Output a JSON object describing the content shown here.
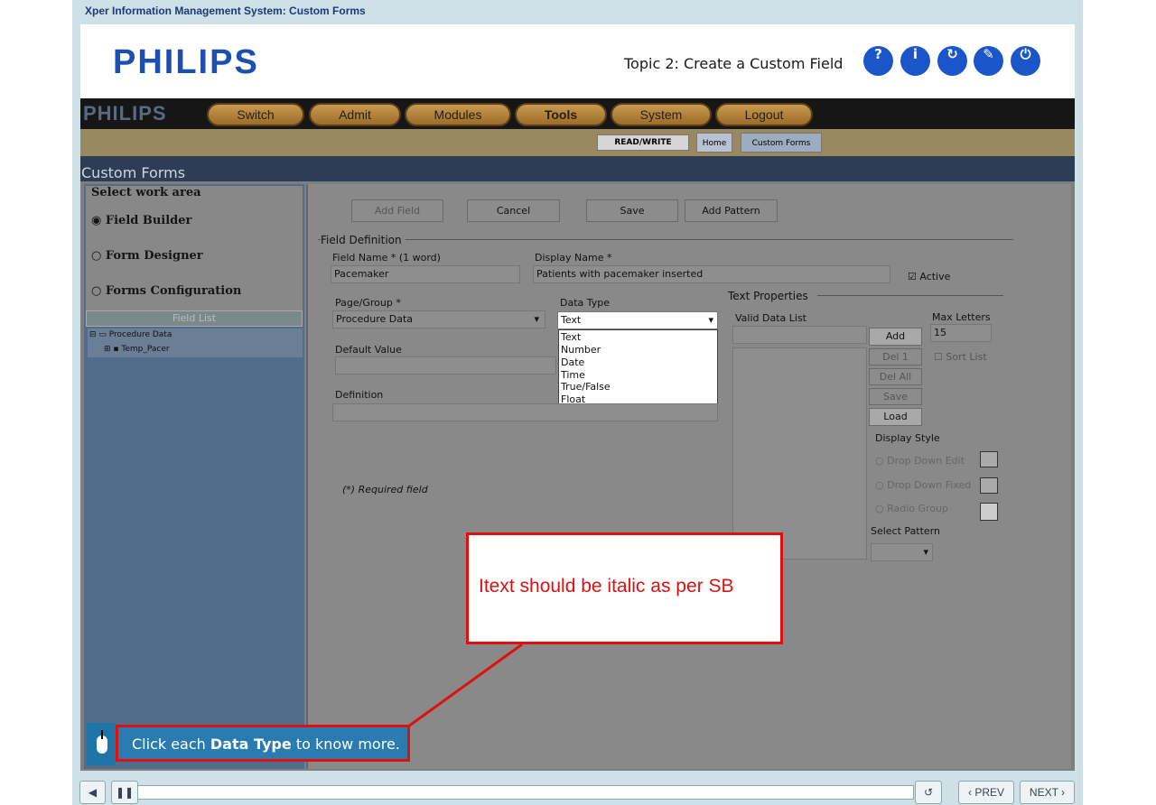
{
  "app_title": "Xper Information Management System: Custom Forms",
  "brand": "PHILIPS",
  "topic": "Topic 2: Create a Custom Field",
  "header_buttons": [
    {
      "icon": "help-icon",
      "glyph": "?"
    },
    {
      "icon": "info-icon",
      "glyph": "i"
    },
    {
      "icon": "replay-icon",
      "glyph": "↻"
    },
    {
      "icon": "pencil-icon",
      "glyph": "✎"
    },
    {
      "icon": "power-icon",
      "glyph": "⏻"
    }
  ],
  "app": {
    "logo": "PHILIPS",
    "menu": [
      "Switch",
      "Admit",
      "Modules",
      "Tools",
      "System",
      "Logout"
    ],
    "readwrite": "READ/WRITE",
    "tabs": [
      "Home",
      "Custom Forms"
    ],
    "section": "Custom Forms",
    "work_area_title": "Select work area",
    "work_areas": [
      "Field Builder",
      "Form Designer",
      "Forms Configuration"
    ],
    "field_list": "Field List",
    "tree": [
      "Procedure Data",
      "Temp_Pacer"
    ],
    "toolbar": [
      "Add Field",
      "Cancel",
      "Save",
      "Add Pattern"
    ],
    "field_definition": "Field Definition",
    "field_name_label": "Field Name  *  (1 word)",
    "field_name_value": "Pacemaker",
    "display_name_label": "Display Name  *",
    "display_name_value": "Patients with pacemaker inserted",
    "active_label": "Active",
    "page_group_label": "Page/Group  *",
    "page_group_value": "Procedure Data",
    "data_type_label": "Data Type",
    "data_type_value": "Text",
    "data_type_options": [
      "Text",
      "Number",
      "Date",
      "Time",
      "True/False",
      "Float"
    ],
    "default_value_label": "Default Value",
    "definition_label": "Definition",
    "required_note": "(*)  Required field",
    "text_properties": "Text Properties",
    "valid_data_list": "Valid Data List",
    "max_letters_label": "Max Letters",
    "max_letters_value": "15",
    "list_buttons": [
      "Add",
      "Del 1",
      "Del All",
      "Save",
      "Load"
    ],
    "sort_list": "Sort List",
    "display_style_label": "Display Style",
    "display_styles": [
      "Drop Down Edit",
      "Drop Down Fixed",
      "Radio Group"
    ],
    "select_pattern": "Select Pattern"
  },
  "callout": "Itext should be italic as per SB",
  "instruction_prefix": "Click each ",
  "instruction_bold": "Data Type",
  "instruction_suffix": " to know more.",
  "nav": {
    "prev": "PREV",
    "next": "NEXT"
  }
}
